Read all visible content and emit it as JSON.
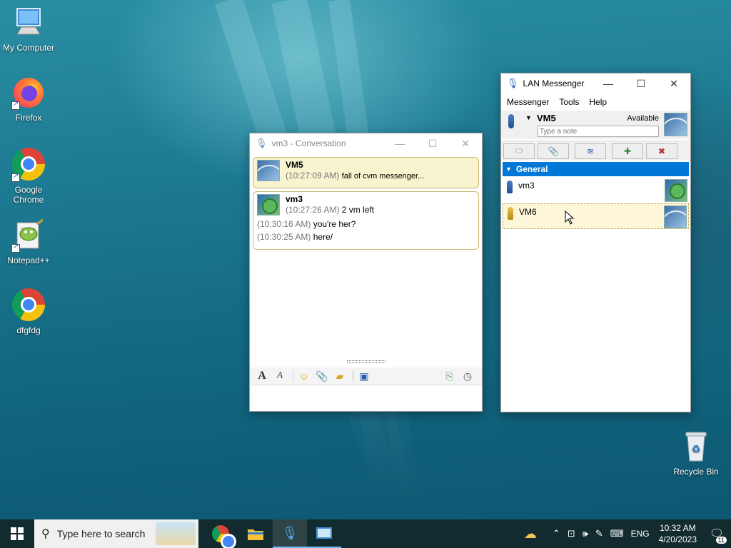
{
  "desktop": {
    "icons": [
      {
        "label": "My Computer"
      },
      {
        "label": "Firefox"
      },
      {
        "label": "Google Chrome"
      },
      {
        "label": "Notepad++"
      },
      {
        "label": "dfgfdg"
      },
      {
        "label": "Recycle Bin"
      }
    ]
  },
  "conversation": {
    "title": "vm3 - Conversation",
    "messages": [
      {
        "sender": "VM5",
        "lines": [
          {
            "time": "(10:27:09 AM)",
            "text": "fall of cvm messenger..."
          }
        ]
      },
      {
        "sender": "vm3",
        "lines": [
          {
            "time": "(10:27:26 AM)",
            "text": "2 vm left"
          },
          {
            "time": "(10:30:16 AM)",
            "text": "you're her?"
          },
          {
            "time": "(10:30:25 AM)",
            "text": "here/"
          }
        ]
      }
    ],
    "input_value": ""
  },
  "lan": {
    "title": "LAN Messenger",
    "menu": [
      "Messenger",
      "Tools",
      "Help"
    ],
    "user": {
      "name": "VM5",
      "status": "Available",
      "note_placeholder": "Type a note"
    },
    "group": "General",
    "contacts": [
      {
        "name": "vm3"
      },
      {
        "name": "VM6"
      }
    ]
  },
  "taskbar": {
    "search_placeholder": "Type here to search",
    "tray": {
      "language": "ENG",
      "time": "10:32 AM",
      "date": "4/20/2023",
      "notifications": "11"
    }
  },
  "colors": {
    "accent": "#0078d7",
    "msg_self_bg": "#f7f4cf",
    "selected_contact": "#fdf6d8"
  }
}
